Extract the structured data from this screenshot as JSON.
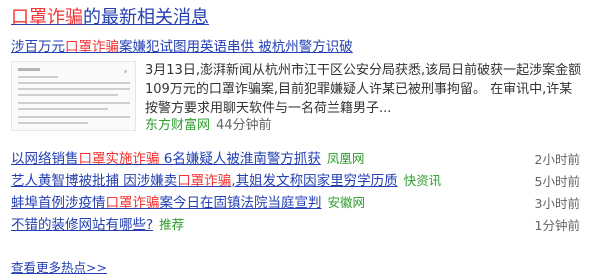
{
  "card": {
    "title_hl": "口罩诈骗",
    "title_rest": "的最新相关消息"
  },
  "top_story": {
    "title_a": "涉百万元",
    "title_hl": "口罩诈骗",
    "title_b": "案嫌犯试图用英语串供 被杭州警方识破",
    "summary": "3月13日,澎湃新闻从杭州市江干区公安分局获悉,该局日前破获一起涉案金额109万元的口罩诈骗案,目前犯罪嫌疑人许某已被刑事拘留。 在审讯中,许某按警方要求用聊天软件与一名荷兰籍男子...",
    "source": "东方财富网",
    "time": "44分钟前"
  },
  "items": [
    {
      "a": "以网络销售",
      "hl": "口罩实施诈骗",
      "b": " 6名嫌疑人被淮南警方抓获",
      "source": "凤凰网",
      "time": "2小时前"
    },
    {
      "a": "艺人黄智博被批捕 因涉嫌卖",
      "hl": "口罩诈骗",
      "b": ",其姐发文称因家里穷学历质",
      "source": "快资讯",
      "time": "5小时前"
    },
    {
      "a": "蚌埠首例涉疫情",
      "hl": "口罩诈骗",
      "b": "案今日在固镇法院当庭宣判",
      "source": "安徽网",
      "time": "3小时前"
    },
    {
      "a": "不错的装修网站有哪些?",
      "hl": "",
      "b": "",
      "source": "推荐",
      "time": "1分钟前"
    }
  ],
  "more_label": "查看更多热点>>"
}
